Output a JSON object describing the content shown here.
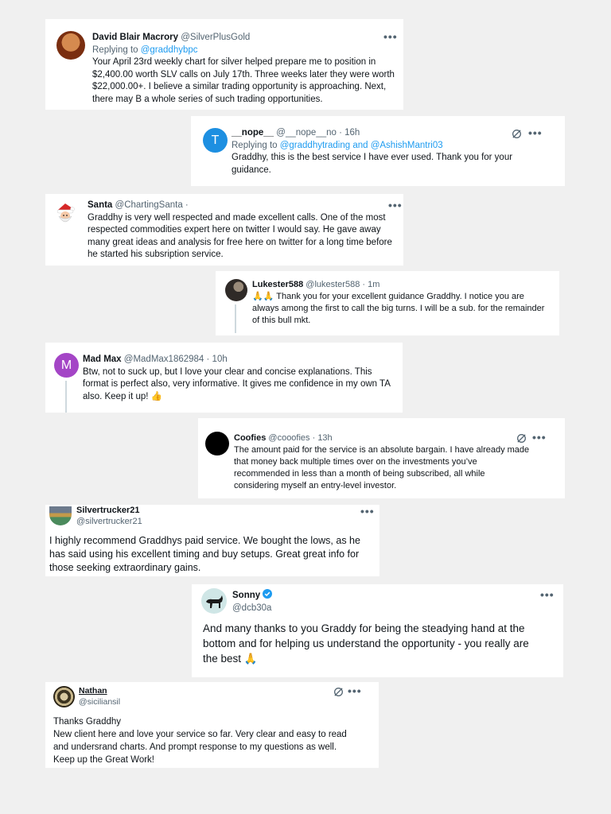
{
  "tweets": {
    "t1": {
      "name": "David Blair Macrory",
      "handle": "@SilverPlusGold",
      "replying_prefix": "Replying to ",
      "replying_to": "@graddhybpc",
      "lines": [
        "Your April 23rd weekly chart for silver helped prepare me to position in",
        "$2,400.00 worth SLV calls on July 17th. Three weeks later they were worth",
        "$22,000.00+. I believe a similar trading opportunity is approaching. Next,",
        "there may B a whole series of such trading opportunities."
      ]
    },
    "t2": {
      "avatar_letter": "T",
      "name": "__nope__",
      "handle": "@__nope__no · 16h",
      "replying_prefix": "Replying to ",
      "replying_to": "@graddhytrading and @AshishMantri03",
      "lines": [
        "Graddhy, this is the best service I have ever used.  Thank you for your",
        "guidance."
      ]
    },
    "t3": {
      "name": "Santa",
      "handle": "@ChartingSanta ·",
      "lines": [
        "Graddhy is very well respected and made excellent calls. One of the most",
        "respected commodities expert here on twitter I would say. He gave away",
        "many great ideas and analysis for free here on twitter for a long time before",
        "he started his subsription service."
      ]
    },
    "t4": {
      "name": "Lukester588",
      "handle": "@lukester588 · 1m",
      "lines": [
        "🙏🙏 Thank you for your excellent guidance Graddhy. I notice you are",
        "always among the first to call the big turns. I will be a sub. for the remainder",
        "of this bull mkt."
      ]
    },
    "t5": {
      "avatar_letter": "M",
      "name": "Mad Max",
      "handle": "@MadMax1862984 · 10h",
      "lines": [
        "Btw, not to suck up, but I love your clear and concise explanations. This",
        "format is perfect also, very informative. It gives me confidence in my own TA",
        "also. Keep it up! 👍"
      ]
    },
    "t6": {
      "name": "Coofies",
      "handle": "@cooofies · 13h",
      "lines": [
        "The amount paid for the service is an absolute bargain. I have already made",
        "that money back multiple times over on the investments you’ve",
        "recommended in less than a month of being subscribed, all while",
        "considering myself an entry-level investor."
      ]
    },
    "t7": {
      "name": "Silvertrucker21",
      "handle": "@silvertrucker21",
      "lines": [
        "I highly recommend Graddhys paid service. We bought the lows, as he",
        "has said using his excellent timing and buy setups. Great great info for",
        "those seeking extraordinary gains."
      ]
    },
    "t8": {
      "name": "Sonny",
      "handle": "@dcb30a",
      "lines": [
        "And many thanks to you Graddy for being the steadying hand at the",
        "bottom and for helping us understand the opportunity - you really are",
        "the best 🙏"
      ]
    },
    "t9": {
      "name": "Nathan",
      "handle": "@siciliansil",
      "lines": [
        "Thanks Graddhy",
        "New client here and love your service so far.  Very clear and easy to read",
        "and undersrand charts. And prompt response to my questions as well.",
        "Keep up the Great Work!"
      ]
    }
  },
  "more_label": "•••",
  "colors": {
    "link": "#1d9bf0",
    "handle": "#536471",
    "t2_avatar": "#1d8fe1",
    "t5_avatar": "#a445c6",
    "verified": "#1d9bf0"
  },
  "icons": [
    "more-icon",
    "grok-icon",
    "verified-badge-icon",
    "santa-avatar-icon",
    "dog-avatar-icon"
  ]
}
